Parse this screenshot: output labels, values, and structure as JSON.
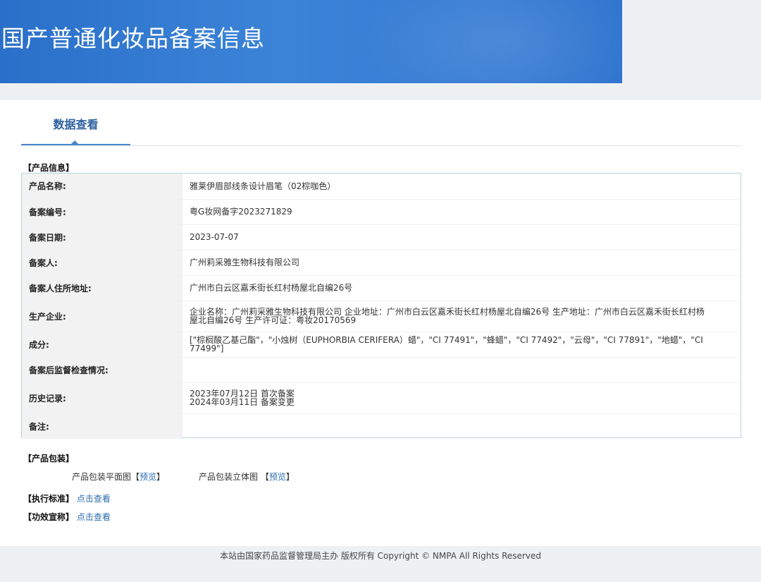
{
  "banner": {
    "title": "国产普通化妆品备案信息"
  },
  "tabs": [
    {
      "label": "数据查看"
    }
  ],
  "product_info": {
    "section_title": "【产品信息】",
    "rows": [
      {
        "label": "产品名称:",
        "value": "雅莱伊眉部线条设计眉笔（02棕咖色）"
      },
      {
        "label": "备案编号:",
        "value": "粤G妆网备字2023271829"
      },
      {
        "label": "备案日期:",
        "value": "2023-07-07"
      },
      {
        "label": "备案人:",
        "value": "广州莉采雅生物科技有限公司"
      },
      {
        "label": "备案人住所地址:",
        "value": "广州市白云区嘉禾街长红村杨屋北自编26号"
      },
      {
        "label": "生产企业:",
        "value_lines": [
          "企业名称：广州莉采雅生物科技有限公司 企业地址：广州市白云区嘉禾街长红村杨屋北自编26号 生产地址：广州市白云区嘉禾街长红村杨",
          "屋北自编26号 生产许可证：粤妆20170569"
        ]
      },
      {
        "label": "成分:",
        "value": "[\"棕榈酸乙基己酯\"，\"小烛树（EUPHORBIA CERIFERA）蜡\"，\"CI 77491\"，\"蜂蜡\"，\"CI 77492\"，\"云母\"，\"CI 77891\"，\"地蜡\"，\"CI 77499\"]"
      },
      {
        "label": "备案后监督检查情况:",
        "value": ""
      },
      {
        "label": "历史记录:",
        "value_lines": [
          "2023年07月12日 首次备案",
          "2024年03月11日 备案变更"
        ]
      },
      {
        "label": "备注:",
        "value": ""
      }
    ]
  },
  "packaging": {
    "section_title": "【产品包装】",
    "flat_label": "产品包装平面图",
    "flat_bracket_open": "【",
    "flat_link": "预览",
    "flat_bracket_close": "】",
    "stereo_label": "产品包装立体图 【",
    "stereo_link": "预览",
    "stereo_bracket_close": "】"
  },
  "standard": {
    "section_title": "【执行标准】",
    "link": "点击查看"
  },
  "efficacy": {
    "section_title": "【功效宣称】",
    "link": "点击查看"
  },
  "footer": {
    "text": "本站由国家药品监督管理局主办 版权所有 Copyright © NMPA All Rights Reserved"
  },
  "colors": {
    "banner": "#2f74cf",
    "link": "#2b6cb0",
    "tab_text": "#2b5f9e"
  }
}
